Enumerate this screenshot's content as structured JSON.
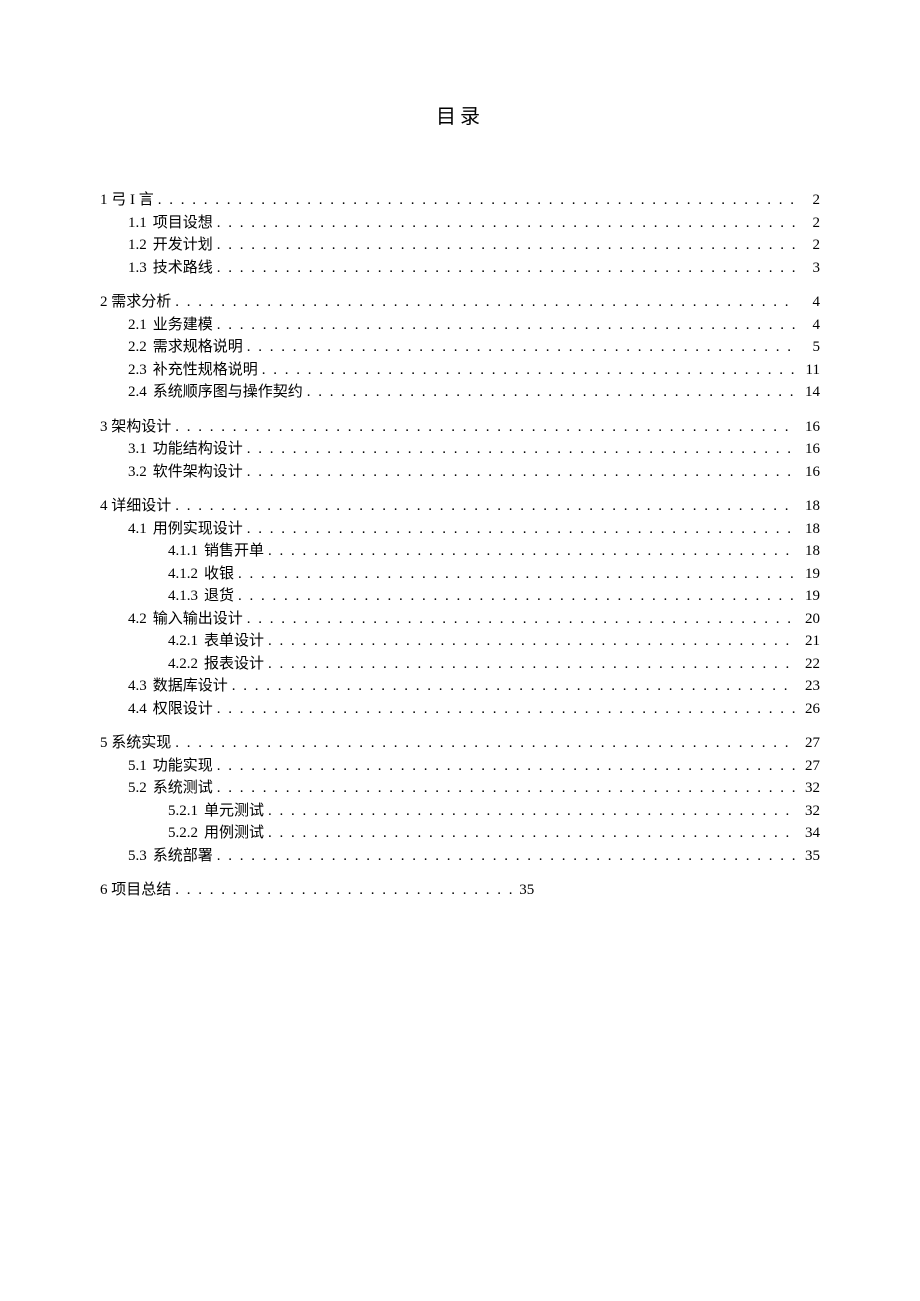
{
  "title": "目录",
  "toc": [
    {
      "entries": [
        {
          "level": 0,
          "num": "1",
          "text": "弓 I 言",
          "page": "2"
        },
        {
          "level": 1,
          "num": "1.1",
          "text": "项目设想",
          "page": "2"
        },
        {
          "level": 1,
          "num": "1.2",
          "text": "开发计划",
          "page": "2"
        },
        {
          "level": 1,
          "num": "1.3",
          "text": "技术路线",
          "page": "3"
        }
      ]
    },
    {
      "entries": [
        {
          "level": 0,
          "num": "2",
          "text": "需求分析",
          "page": "4"
        },
        {
          "level": 1,
          "num": "2.1",
          "text": "业务建模",
          "page": "4"
        },
        {
          "level": 1,
          "num": "2.2",
          "text": "需求规格说明",
          "page": "5"
        },
        {
          "level": 1,
          "num": "2.3",
          "text": "补充性规格说明",
          "page": "11"
        },
        {
          "level": 1,
          "num": "2.4",
          "text": "系统顺序图与操作契约",
          "page": "14"
        }
      ]
    },
    {
      "entries": [
        {
          "level": 0,
          "num": "3",
          "text": "架构设计",
          "page": "16"
        },
        {
          "level": 1,
          "num": "3.1",
          "text": "功能结构设计",
          "page": "16"
        },
        {
          "level": 1,
          "num": "3.2",
          "text": "软件架构设计",
          "page": "16"
        }
      ]
    },
    {
      "entries": [
        {
          "level": 0,
          "num": "4",
          "text": "详细设计",
          "page": "18"
        },
        {
          "level": 1,
          "num": "4.1",
          "text": "用例实现设计",
          "page": "18"
        },
        {
          "level": 2,
          "num": "4.1.1",
          "text": "销售开单",
          "page": "18"
        },
        {
          "level": 2,
          "num": "4.1.2",
          "text": "收银",
          "page": "19"
        },
        {
          "level": 2,
          "num": "4.1.3",
          "text": "退货",
          "page": "19"
        },
        {
          "level": 1,
          "num": "4.2",
          "text": "输入输出设计",
          "page": "20"
        },
        {
          "level": 2,
          "num": "4.2.1",
          "text": "表单设计",
          "page": "21"
        },
        {
          "level": 2,
          "num": "4.2.2",
          "text": "报表设计",
          "page": "22"
        },
        {
          "level": 1,
          "num": "4.3",
          "text": "数据库设计",
          "page": "23"
        },
        {
          "level": 1,
          "num": "4.4",
          "text": "权限设计",
          "page": "26"
        }
      ]
    },
    {
      "entries": [
        {
          "level": 0,
          "num": "5",
          "text": "系统实现",
          "page": "27"
        },
        {
          "level": 1,
          "num": "5.1",
          "text": "功能实现",
          "page": "27"
        },
        {
          "level": 1,
          "num": "5.2",
          "text": "系统测试",
          "page": "32"
        },
        {
          "level": 2,
          "num": "5.2.1",
          "text": "单元测试",
          "page": "32"
        },
        {
          "level": 2,
          "num": "5.2.2",
          "text": "用例测试",
          "page": "34"
        },
        {
          "level": 1,
          "num": "5.3",
          "text": "系统部署",
          "page": "35"
        }
      ]
    },
    {
      "entries": [
        {
          "level": 0,
          "num": "6",
          "text": "项目总结",
          "page": "35",
          "short": true
        }
      ]
    }
  ]
}
